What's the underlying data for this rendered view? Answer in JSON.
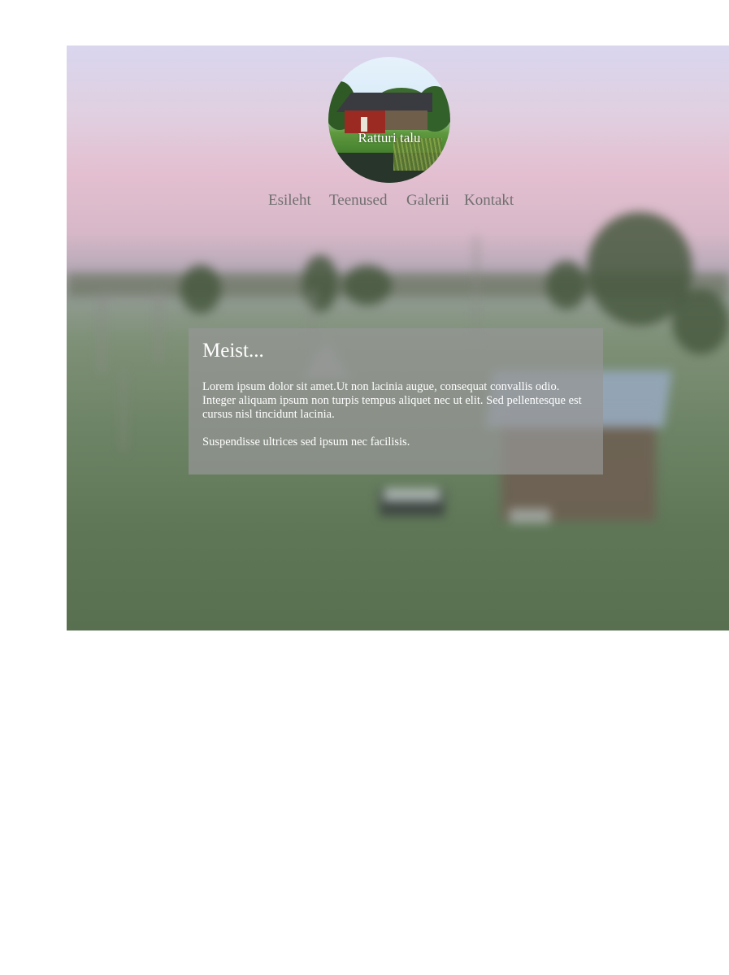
{
  "site": {
    "logo_label": "Ratturi talu"
  },
  "nav": {
    "items": [
      {
        "label": "Esileht"
      },
      {
        "label": "Teenused"
      },
      {
        "label": "Galerii"
      },
      {
        "label": "Kontakt"
      }
    ]
  },
  "content": {
    "heading": "Meist...",
    "paragraph1": "Lorem ipsum dolor sit amet.Ut non lacinia augue, consequat convallis odio. Integer aliquam ipsum non turpis tempus aliquet nec ut elit. Sed pellentesque est cursus nisl tincidunt lacinia.",
    "paragraph2": "Suspendisse ultrices sed ipsum nec facilisis."
  }
}
